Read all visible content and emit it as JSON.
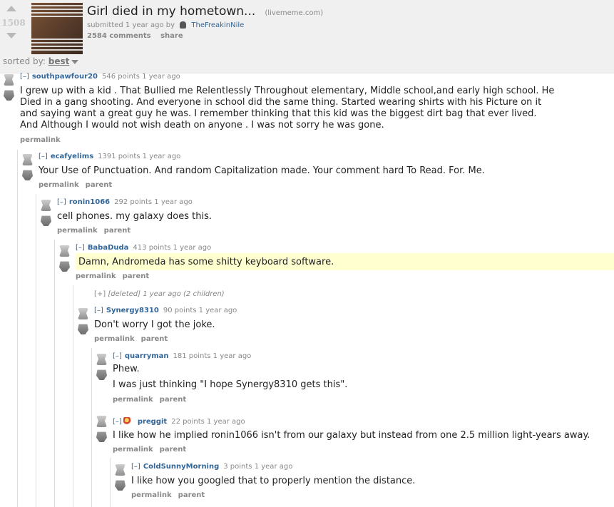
{
  "post": {
    "score": "1508",
    "title": "Girl died in my hometown...",
    "domain": "(livememe.com)",
    "submitted": "submitted 1 year ago by",
    "author": "TheFreakinNile",
    "comments": "2584 comments",
    "share": "share"
  },
  "sort": {
    "label": "sorted by:",
    "value": "best"
  },
  "comments": [
    {
      "toggle": "[–]",
      "user": "southpawfour20",
      "points": "546 points 1 year ago",
      "body": "I grew up with a kid . That Bullied me Relentlessly Throughout elementary, Middle school,and early high school. He\nDied in a gang shooting. And everyone in school did the same thing. Started wearing shirts with his Picture on it\nand saying want a great guy he was. I remember thinking that this kid was the biggest dirt bag that ever lived.\nAnd Although I would not wish death on anyone . I was not sorry he was gone.",
      "actions": [
        "permalink"
      ]
    },
    {
      "toggle": "[–]",
      "user": "ecafyelims",
      "points": "1391 points 1 year ago",
      "body": "Your Use of Punctuation. And random Capitalization made. Your comment hard To Read. For. Me.",
      "actions": [
        "permalink",
        "parent"
      ]
    },
    {
      "toggle": "[–]",
      "user": "ronin1066",
      "points": "292 points 1 year ago",
      "body": "cell phones. my galaxy does this.",
      "actions": [
        "permalink",
        "parent"
      ]
    },
    {
      "toggle": "[–]",
      "user": "BabaDuda",
      "points": "413 points 1 year ago",
      "body": "Damn, Andromeda has some shitty keyboard software.",
      "actions": [
        "permalink",
        "parent"
      ]
    },
    {
      "toggle": "[–]",
      "user": "Synergy8310",
      "points": "90 points 1 year ago",
      "body": "Don't worry I got the joke.",
      "actions": [
        "permalink",
        "parent"
      ]
    },
    {
      "toggle": "[–]",
      "user": "quarryman",
      "points": "181 points 1 year ago",
      "body": "Phew.\n\nI was just thinking \"I hope Synergy8310 gets this\".",
      "actions": [
        "permalink",
        "parent"
      ]
    },
    {
      "toggle": "[–]",
      "user": "preggit",
      "points": "22 points 1 year ago",
      "body": "I like how he implied ronin1066 isn't from our galaxy but instead from one 2.5 million light-years away.",
      "actions": [
        "permalink",
        "parent"
      ]
    },
    {
      "toggle": "[–]",
      "user": "ColdSunnyMorning",
      "points": "3 points 1 year ago",
      "body": "I like how you googled that to properly mention the distance.",
      "actions": [
        "permalink",
        "parent"
      ]
    }
  ],
  "deleted": {
    "toggle": "[+]",
    "text": "[deleted] 1 year ago (2 children)"
  }
}
